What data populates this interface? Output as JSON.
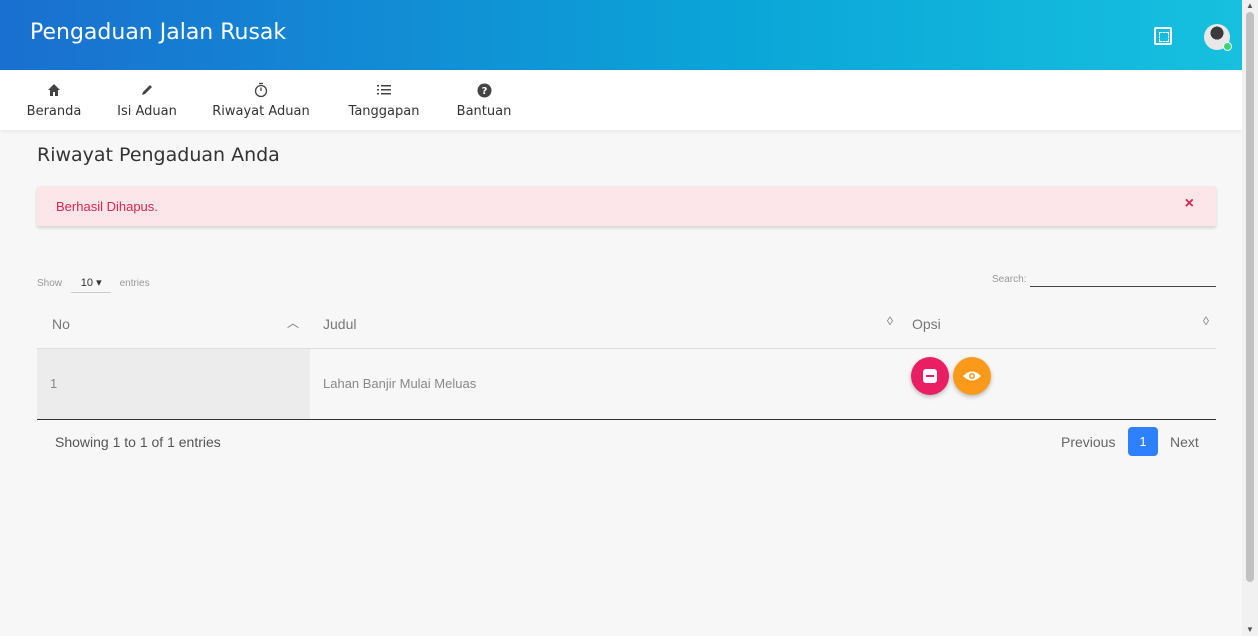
{
  "app": {
    "title": "Pengaduan Jalan Rusak",
    "fullscreen_icon": "fullscreen-icon",
    "avatar_icon": "user-avatar",
    "accent": "#1a6fd0"
  },
  "nav": {
    "items": [
      {
        "label": "Beranda",
        "icon": "home-icon"
      },
      {
        "label": "Isi Aduan",
        "icon": "pencil-icon"
      },
      {
        "label": "Riwayat Aduan",
        "icon": "timer-icon"
      },
      {
        "label": "Tanggapan",
        "icon": "list-icon"
      },
      {
        "label": "Bantuan",
        "icon": "help-icon"
      }
    ]
  },
  "page": {
    "title": "Riwayat Pengaduan Anda"
  },
  "alert": {
    "message": "Berhasil Dihapus.",
    "close": "×",
    "color": "#d9264a"
  },
  "table": {
    "length": {
      "prefix": "Show",
      "value": "10",
      "suffix": "entries"
    },
    "search_label": "Search:",
    "headers": [
      "No",
      "Judul",
      "Opsi"
    ],
    "rows": [
      {
        "no": "1",
        "judul": "Lahan Banjir Mulai Meluas"
      }
    ],
    "info": "Showing 1 to 1 of 1 entries",
    "pagination": {
      "previous": "Previous",
      "current": "1",
      "next": "Next"
    }
  }
}
